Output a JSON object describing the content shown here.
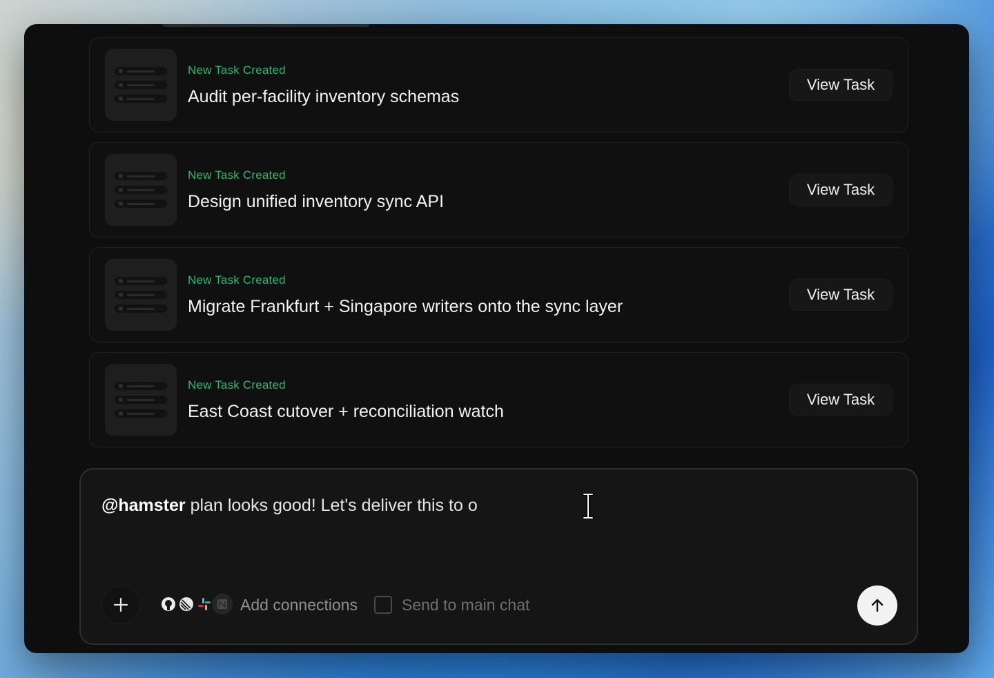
{
  "tasks": [
    {
      "tag": "New Task Created",
      "title": "Audit per-facility inventory schemas",
      "button": "View Task"
    },
    {
      "tag": "New Task Created",
      "title": "Design unified inventory sync API",
      "button": "View Task"
    },
    {
      "tag": "New Task Created",
      "title": "Migrate Frankfurt + Singapore writers onto the sync layer",
      "button": "View Task"
    },
    {
      "tag": "New Task Created",
      "title": "East Coast cutover + reconciliation watch",
      "button": "View Task"
    }
  ],
  "composer": {
    "mention": "@hamster",
    "text": " plan looks good! Let's deliver this to o",
    "add_connections": "Add connections",
    "send_to_main_chat": "Send to main chat",
    "connections": [
      "github-icon",
      "linear-icon",
      "slack-icon",
      "notion-icon"
    ]
  },
  "colors": {
    "accent_green": "#2fb872",
    "window_bg": "#0e0e0e",
    "card_border": "#222222"
  }
}
